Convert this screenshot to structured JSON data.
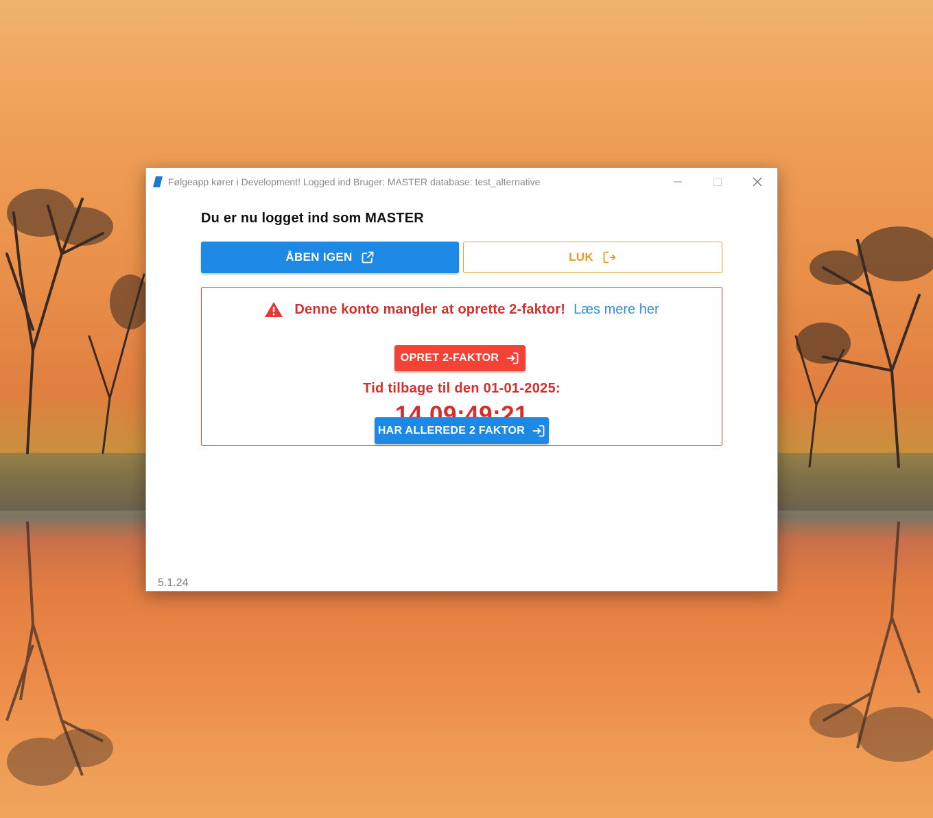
{
  "window": {
    "title": "Følgeapp kører i Development! Logged ind Bruger: MASTER database: test_alternative"
  },
  "main": {
    "heading": "Du er nu logget ind som MASTER",
    "open_again_label": "ÅBEN IGEN",
    "close_label": "LUK"
  },
  "alert": {
    "message": "Denne konto mangler at oprette 2-faktor!",
    "link_text": "Læs mere her",
    "create_button_label": "OPRET 2-FAKTOR",
    "deadline_text": "Tid tilbage til den 01-01-2025:",
    "countdown": "14 09:49:21"
  },
  "footer": {
    "already_button_label": "HAR ALLEREDE 2 FAKTOR",
    "version": "5.1.24"
  },
  "colors": {
    "primary": "#1e88e5",
    "warning_outline": "#e8a13c",
    "error": "#d32f2f",
    "error_button": "#f44336",
    "link": "#2f8fdd"
  },
  "icons": {
    "app": "app-logo-icon",
    "open_again": "open-in-new-icon",
    "close": "logout-icon",
    "warning": "warning-triangle-icon",
    "create": "login-icon",
    "already": "login-icon"
  }
}
